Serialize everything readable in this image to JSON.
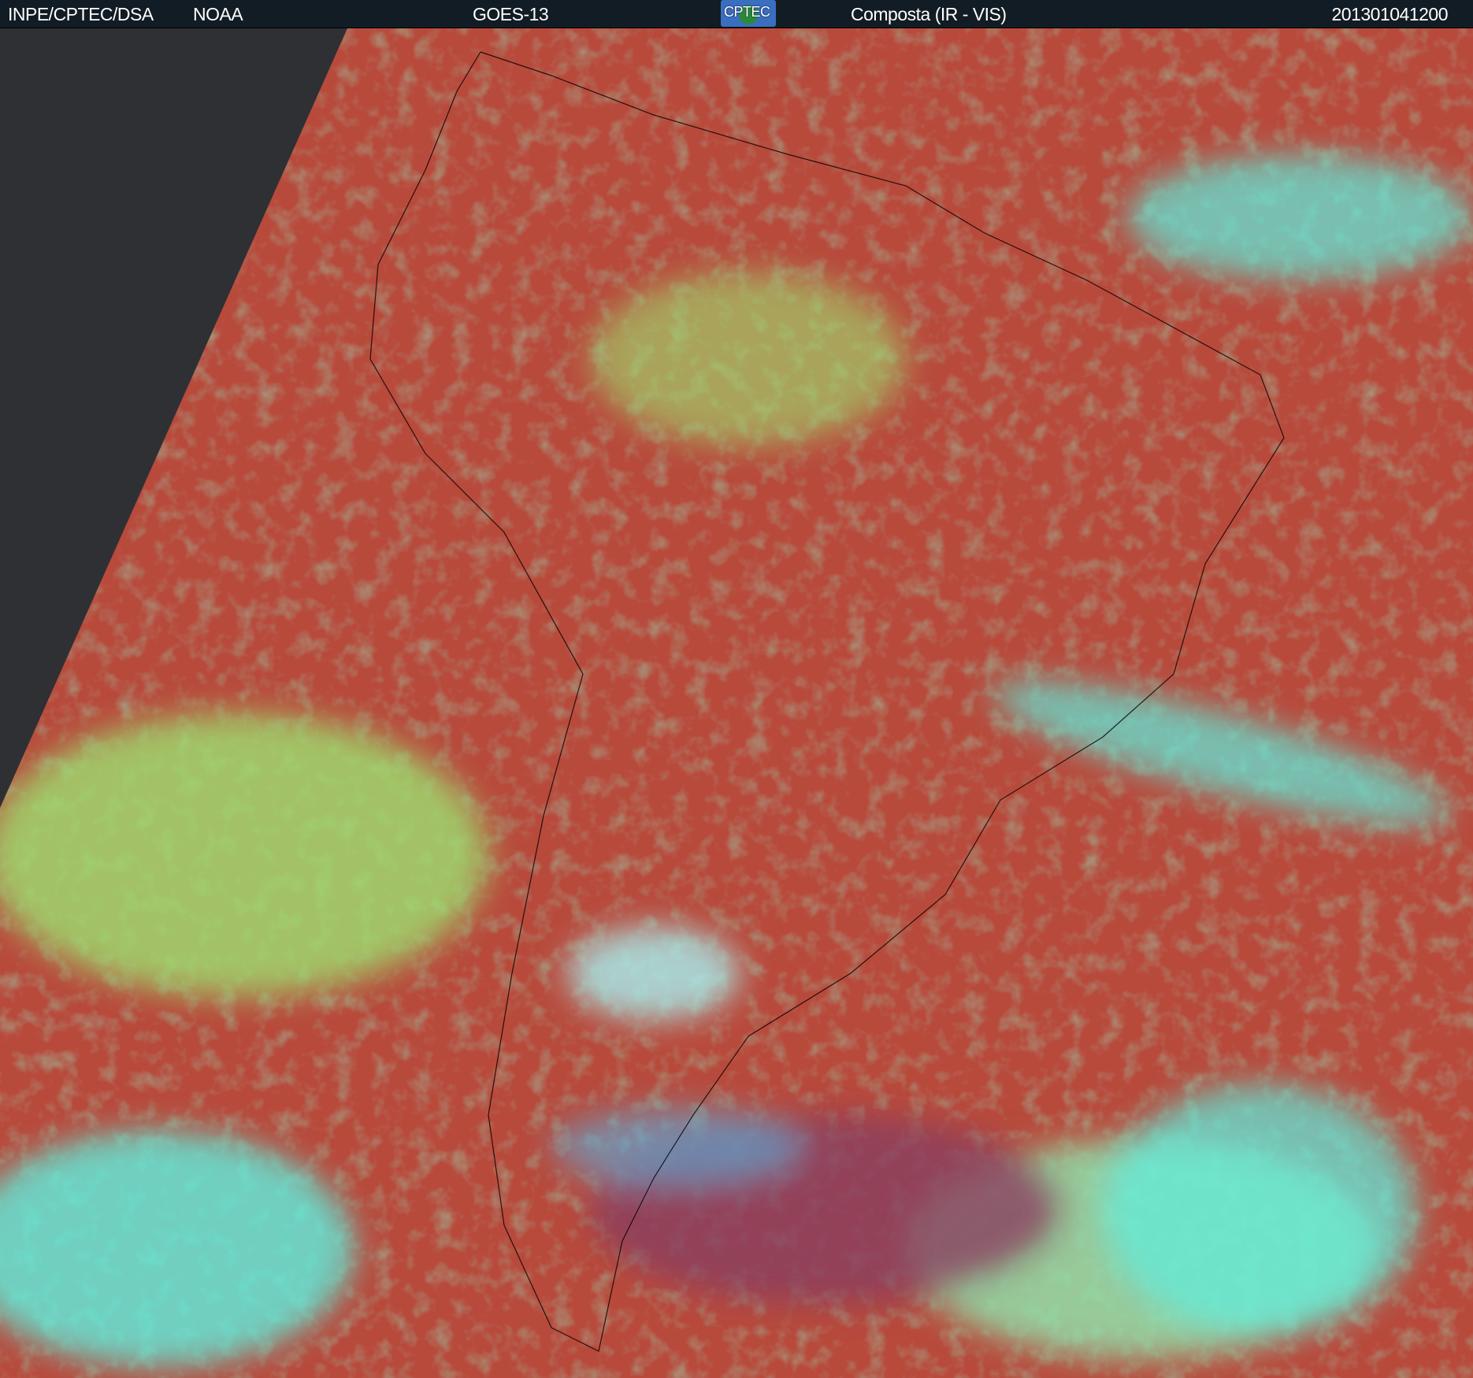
{
  "header": {
    "agency": "INPE/CPTEC/DSA",
    "partner": "NOAA",
    "satellite": "GOES-13",
    "logo_text": "CPTEC",
    "product": "Composta (IR - VIS)",
    "timestamp": "201301041200"
  },
  "colors": {
    "header_bg": "#121c24",
    "ocean_red": "#b84a3c",
    "cloud_green": "#8ee06a",
    "cloud_cyan": "#5ef0e0",
    "night_gray": "#2f3033"
  },
  "icons": [
    "cptec-logo-icon"
  ]
}
